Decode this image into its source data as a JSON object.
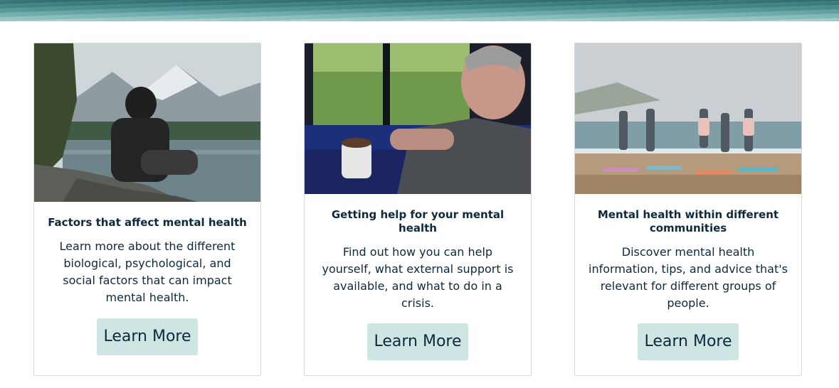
{
  "banner": {
    "image_icon": "water-banner-image"
  },
  "cards": [
    {
      "image_icon": "person-sitting-by-mountain-lake-photo",
      "title": "Factors that affect mental health",
      "description": "Learn more about the different biological, psychological, and social factors that can impact mental health.",
      "button_label": "Learn More"
    },
    {
      "image_icon": "person-holding-coffee-mug-photo",
      "title": "Getting help for your mental health",
      "description": "Find out how you can help yourself, what external support is available, and what to do in a crisis.",
      "button_label": "Learn More"
    },
    {
      "image_icon": "group-yoga-on-beach-photo",
      "title": "Mental health within different communities",
      "description": "Discover mental health information, tips, and advice that's relevant for different groups of people.",
      "button_label": "Learn More"
    }
  ],
  "colors": {
    "text": "#0d2a3d",
    "button_bg": "#cde5e3",
    "card_border": "#d9d9d9",
    "banner": "#4a9094"
  }
}
